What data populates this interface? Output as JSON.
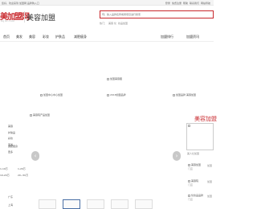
{
  "topbar": {
    "left_text": "您好，欢迎来到 加盟网 品牌购入口",
    "links": [
      "登录",
      "免费注册",
      "帮助",
      "联系我们",
      "网站导航"
    ]
  },
  "header": {
    "logo_main": "美加盟网",
    "logo_sub": "mjm.com",
    "site_title": "美容加盟"
  },
  "search": {
    "placeholder": "输入品牌名称或者项目进行搜索",
    "hot_words": [
      "热门：",
      "美容 化",
      "妆品加盟"
    ]
  },
  "nav": {
    "items": [
      "首页",
      "美发",
      "美容",
      "彩妆",
      "护肤品",
      "减肥瘦身"
    ],
    "right": [
      "加盟排行",
      "加盟资讯"
    ]
  },
  "images": {
    "center_top": "加盟美容图",
    "row_left": "加盟中心中心加盟",
    "row_mid": "2018加盟品牌",
    "row_right": "加盟品牌 美容加盟"
  },
  "banner": {
    "label": "美容院产品加盟",
    "prev": "‹",
    "next": "›"
  },
  "side": {
    "items": [
      "美容",
      "护肤品",
      "彩妆",
      "美发",
      "减肥瘦身",
      "更多"
    ],
    "left_items": [
      "1-10万",
      "10-20万"
    ],
    "bottom_left": [
      "广东",
      "上海"
    ],
    "mid_tags": [
      "1-20万",
      "20~50万"
    ]
  },
  "panel": {
    "title": "美容加盟",
    "caption": "美人社加盟",
    "rows": [
      {
        "label": "美容加盟",
        "sub": "门店",
        "right": "加盟"
      },
      {
        "label": "美容院",
        "sub": "门店",
        "right": "加盟"
      },
      {
        "label": "化妆品品牌",
        "sub": "门店",
        "right": "加盟"
      }
    ]
  }
}
